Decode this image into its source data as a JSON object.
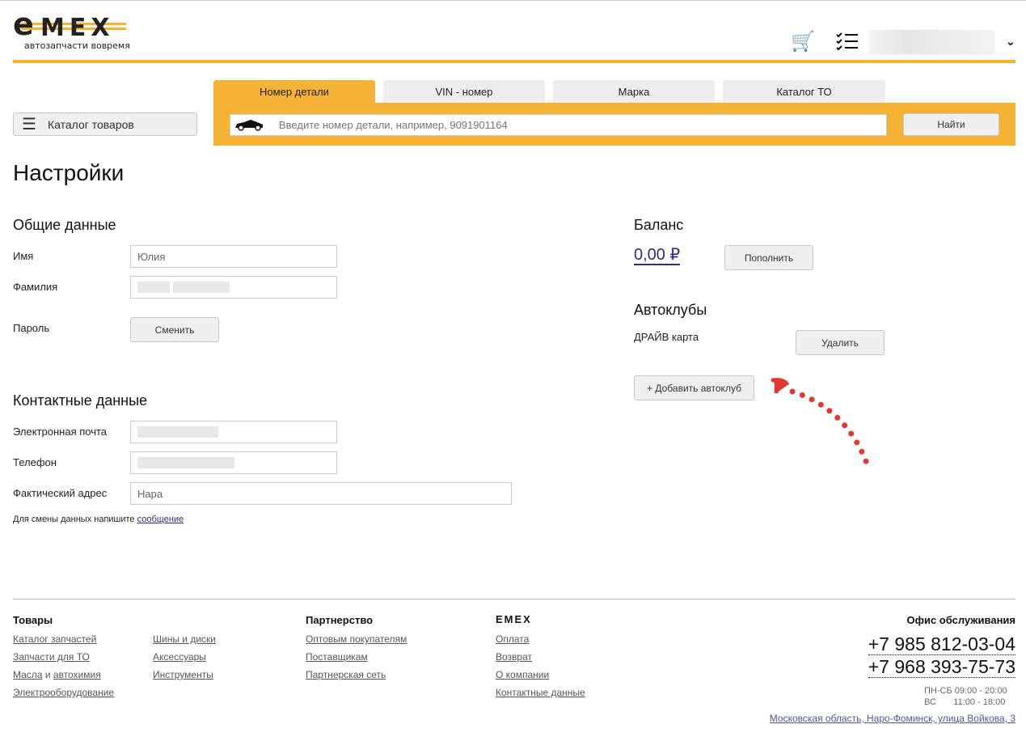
{
  "header": {
    "logo_text": "EMEX",
    "tagline": "автозапчасти вовремя"
  },
  "catalog_button": "Каталог товаров",
  "search": {
    "tabs": [
      "Номер детали",
      "VIN - номер",
      "Марка",
      "Каталог ТО"
    ],
    "placeholder": "Введите номер детали, например, 9091901164",
    "button": "Найти"
  },
  "page_title": "Настройки",
  "general": {
    "title": "Общие данные",
    "name_label": "Имя",
    "name_value": "Юлия",
    "surname_label": "Фамилия",
    "password_label": "Пароль",
    "password_button": "Сменить"
  },
  "contacts": {
    "title": "Контактные данные",
    "email_label": "Электронная почта",
    "phone_label": "Телефон",
    "address_label": "Фактический адрес",
    "address_value": "Нара",
    "note": "Для смены данных напишите",
    "note_link": "сообщение"
  },
  "balance": {
    "title": "Баланс",
    "amount": "0,00 ₽",
    "topup_button": "Пополнить"
  },
  "autoclubs": {
    "title": "Автоклубы",
    "club": "ДРАЙВ карта",
    "delete_button": "Удалить",
    "add_button": "+ Добавить автоклуб"
  },
  "footer": {
    "goods": {
      "title": "Товары",
      "col1": [
        "Каталог запчастей",
        "Запчасти для ТО",
        "Масла",
        "и",
        "автохимия",
        "Электрооборудование"
      ],
      "col2": [
        "Шины и диски",
        "Аксессуары",
        "Инструменты"
      ]
    },
    "partners": {
      "title": "Партнерство",
      "links": [
        "Оптовым покупателям",
        "Поставщикам",
        "Партнерская сеть"
      ]
    },
    "emex": {
      "title": "EMEX",
      "links": [
        "Оплата",
        "Возврат",
        "О компании",
        "Контактные данные"
      ]
    },
    "office": {
      "title": "Офис обслуживания",
      "phones": [
        "+7 985 812-03-04",
        "+7 968 393-75-73"
      ],
      "hours": [
        "ПН-СБ 09:00 - 20:00",
        "ВС       11:00 - 18:00"
      ],
      "address": "Московская область, Наро-Фоминск, улица Войкова, 3"
    }
  },
  "colors": {
    "accent": "#f5b335",
    "link": "#2d2d7a",
    "arrow": "#e03a30"
  }
}
